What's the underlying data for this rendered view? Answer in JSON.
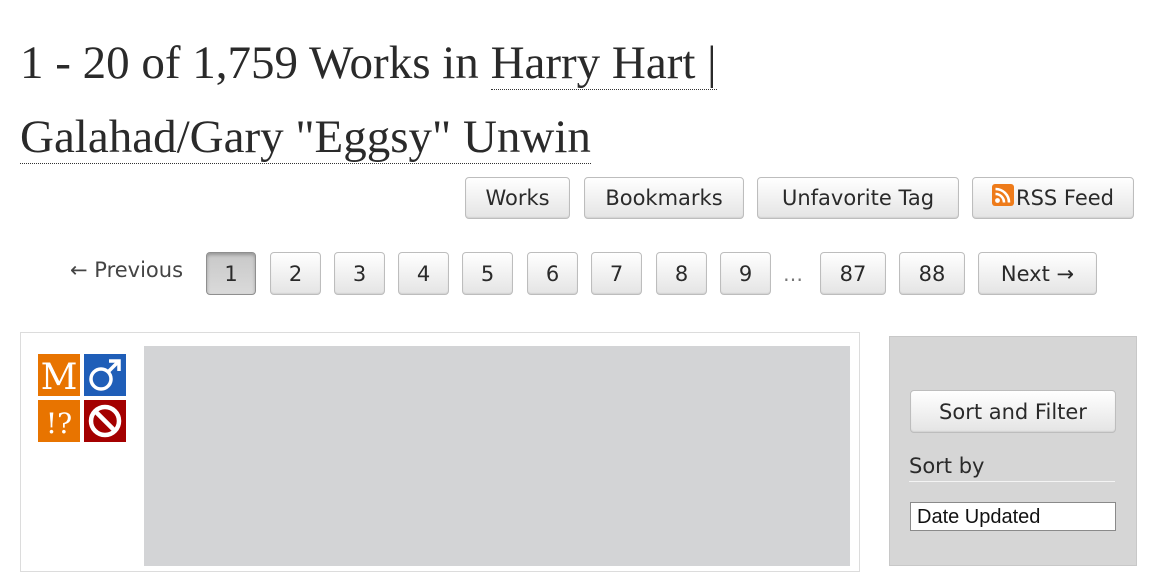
{
  "heading": {
    "prefix": "1 - 20 of 1,759 Works in ",
    "tag_line1": "Harry Hart |",
    "tag_line2": "Galahad/Gary \"Eggsy\" Unwin"
  },
  "nav": {
    "works": "Works",
    "bookmarks": "Bookmarks",
    "unfavorite": "Unfavorite Tag",
    "rss": "RSS Feed"
  },
  "pagination": {
    "previous": "← Previous",
    "pages": [
      "1",
      "2",
      "3",
      "4",
      "5",
      "6",
      "7",
      "8",
      "9"
    ],
    "current": "1",
    "gap": "…",
    "last_pages": [
      "87",
      "88"
    ],
    "next": "Next →"
  },
  "work": {
    "required_tags": [
      {
        "name": "rating-mature-icon",
        "glyph": "M",
        "color": "#e87400"
      },
      {
        "name": "category-mm-icon",
        "glyph": "♂",
        "color": "#1f5eb8"
      },
      {
        "name": "warnings-choose-not-icon",
        "glyph": "!?",
        "color": "#e87400"
      },
      {
        "name": "complete-status-icon",
        "glyph": "",
        "color": "#a40000"
      }
    ]
  },
  "sidebar": {
    "sort_filter_button": "Sort and Filter",
    "sort_by_label": "Sort by",
    "sort_by_value": "Date Updated"
  }
}
